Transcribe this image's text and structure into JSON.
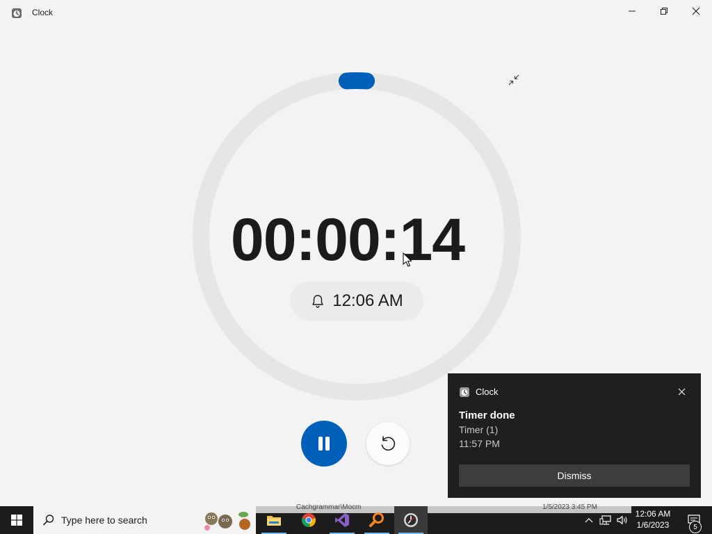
{
  "window": {
    "title": "Clock"
  },
  "timer": {
    "remaining": "00:00:14",
    "end_time": "12:06 AM",
    "progress_remaining": 0.02,
    "colors": {
      "accent": "#005fb8",
      "track": "#e6e6e6"
    }
  },
  "notification": {
    "app": "Clock",
    "title": "Timer done",
    "line1": "Timer (1)",
    "line2": "11:57 PM",
    "dismiss_label": "Dismiss"
  },
  "taskbar": {
    "search_placeholder": "Type here to search",
    "background_window_text_1": "Cachgrammar\\Mocm",
    "background_window_text_2": "1/5/2023 3:45 PM",
    "clock_time": "12:06 AM",
    "clock_date": "1/6/2023",
    "notification_count": "5",
    "apps": [
      "file-explorer-icon",
      "chrome-icon",
      "visual-studio-icon",
      "search-tool-icon",
      "clock-app-icon"
    ]
  }
}
